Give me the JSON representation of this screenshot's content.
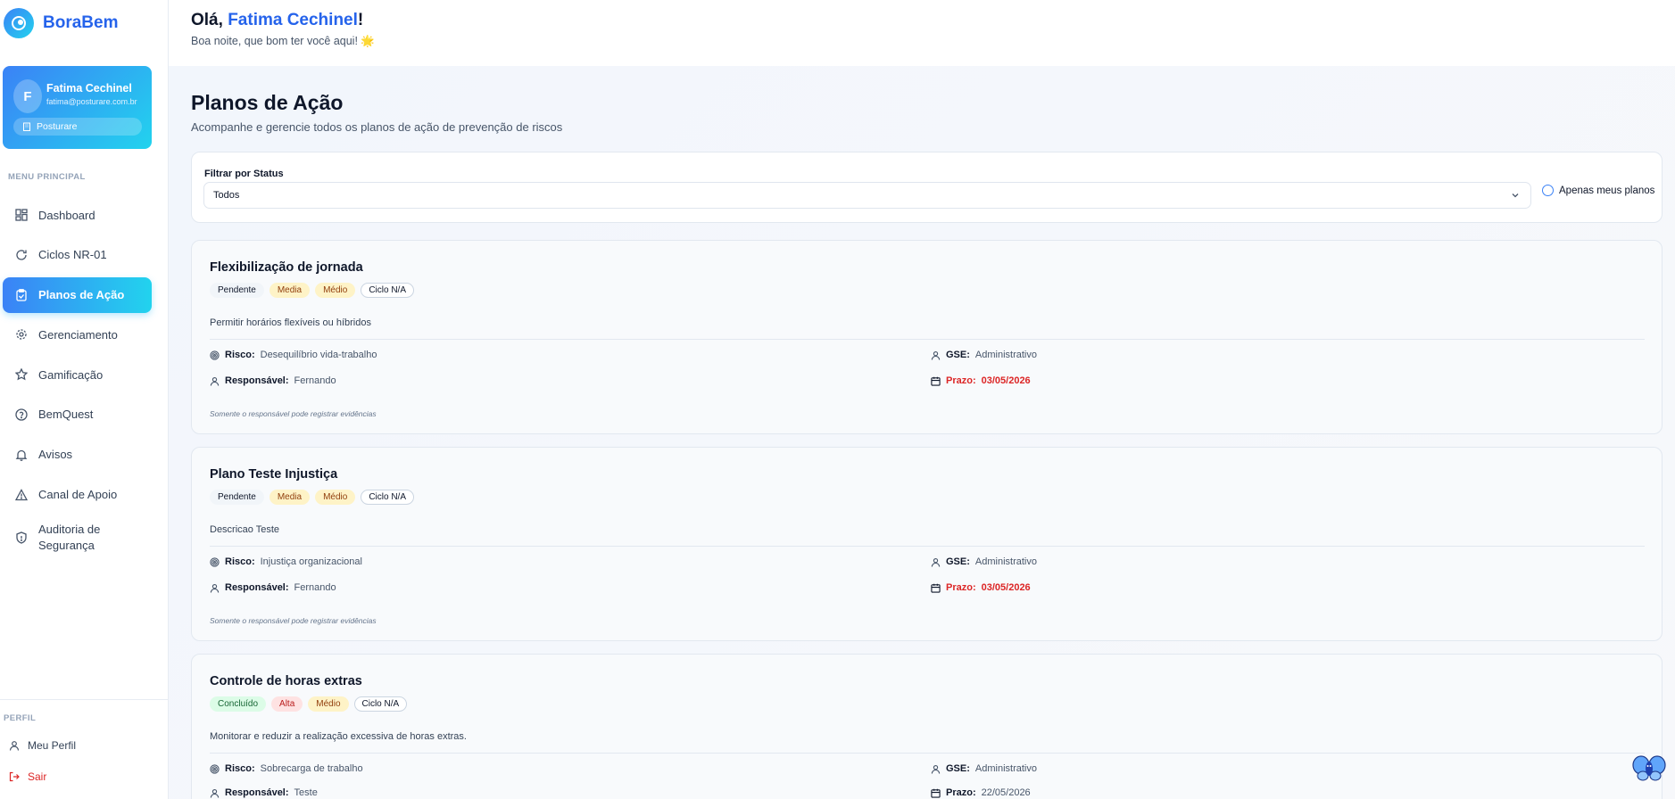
{
  "app": {
    "name": "BoraBem"
  },
  "user": {
    "initial": "F",
    "name": "Fatima Cechinel",
    "email": "fatima@posturare.com.br",
    "company": "Posturare"
  },
  "sidebar": {
    "menu_label": "MENU PRINCIPAL",
    "items": [
      {
        "label": "Dashboard",
        "icon": "grid-icon"
      },
      {
        "label": "Ciclos NR-01",
        "icon": "refresh-icon"
      },
      {
        "label": "Planos de Ação",
        "icon": "clipboard-check-icon",
        "active": true
      },
      {
        "label": "Gerenciamento",
        "icon": "gear-icon"
      },
      {
        "label": "Gamificação",
        "icon": "star-icon"
      },
      {
        "label": "BemQuest",
        "icon": "help-circle-icon"
      },
      {
        "label": "Avisos",
        "icon": "bell-icon"
      },
      {
        "label": "Canal de Apoio",
        "icon": "alert-triangle-icon"
      },
      {
        "label": "Auditoria de Segurança",
        "icon": "shield-icon"
      }
    ],
    "profile_label": "PERFIL",
    "my_profile": "Meu Perfil",
    "logout": "Sair"
  },
  "header": {
    "greeting_prefix": "Olá, ",
    "greeting_name": "Fatima Cechinel",
    "greeting_suffix": "!",
    "subtitle": "Boa noite, que bom ter você aqui! 🌟"
  },
  "page": {
    "title": "Planos de Ação",
    "subtitle": "Acompanhe e gerencie todos os planos de ação de prevenção de riscos"
  },
  "filter": {
    "label": "Filtrar por Status",
    "selected": "Todos",
    "checkbox_label": "Apenas meus planos"
  },
  "labels": {
    "risco": "Risco:",
    "gse": "GSE:",
    "responsavel": "Responsável:",
    "prazo": "Prazo:"
  },
  "plans": [
    {
      "title": "Flexibilização de jornada",
      "status": "Pendente",
      "priority": "Media",
      "level": "Médio",
      "cycle": "Ciclo N/A",
      "description": "Permitir horários flexíveis ou híbridos",
      "risk": "Desequilíbrio vida-trabalho",
      "gse": "Administrativo",
      "responsible": "Fernando",
      "deadline": "03/05/2026",
      "note": "Somente o responsável pode registrar evidências"
    },
    {
      "title": "Plano Teste Injustiça",
      "status": "Pendente",
      "priority": "Media",
      "level": "Médio",
      "cycle": "Ciclo N/A",
      "description": "Descricao Teste",
      "risk": "Injustiça organizacional",
      "gse": "Administrativo",
      "responsible": "Fernando",
      "deadline": "03/05/2026",
      "note": "Somente o responsável pode registrar evidências"
    },
    {
      "title": "Controle de horas extras",
      "status": "Concluído",
      "priority": "Alta",
      "level": "Médio",
      "cycle": "Ciclo N/A",
      "description": "Monitorar e reduzir a realização excessiva de horas extras.",
      "risk": "Sobrecarga de trabalho",
      "gse": "Administrativo",
      "responsible": "Teste",
      "deadline": "22/05/2026"
    }
  ],
  "colors": {
    "accent": "#2563eb",
    "gradient_start": "#3b82f6",
    "gradient_end": "#22d3ee",
    "danger": "#dc2626"
  }
}
